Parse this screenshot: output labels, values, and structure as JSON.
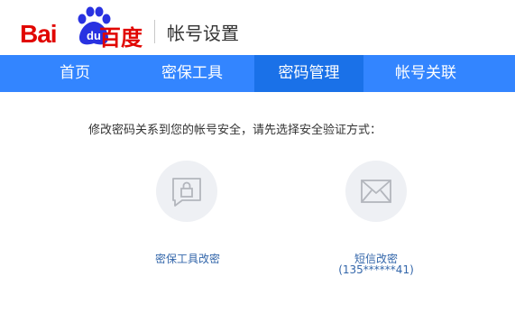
{
  "header": {
    "logo_text_latin": "Bai",
    "logo_text_du": "du",
    "logo_text_cn": "百度",
    "title": "帐号设置",
    "brand_color": "#e10601"
  },
  "nav": {
    "items": [
      {
        "label": "首页",
        "active": false
      },
      {
        "label": "密保工具",
        "active": false
      },
      {
        "label": "密码管理",
        "active": true
      },
      {
        "label": "帐号关联",
        "active": false
      }
    ],
    "bg_color": "#3385ff",
    "active_color": "#1a71e8"
  },
  "main": {
    "prompt": "修改密码关系到您的帐号安全，请先选择安全验证方式：",
    "options": [
      {
        "icon": "lock-message-icon",
        "label": "密保工具改密",
        "sub": ""
      },
      {
        "icon": "envelope-icon",
        "label": "短信改密",
        "sub": "(135******41)"
      }
    ]
  }
}
